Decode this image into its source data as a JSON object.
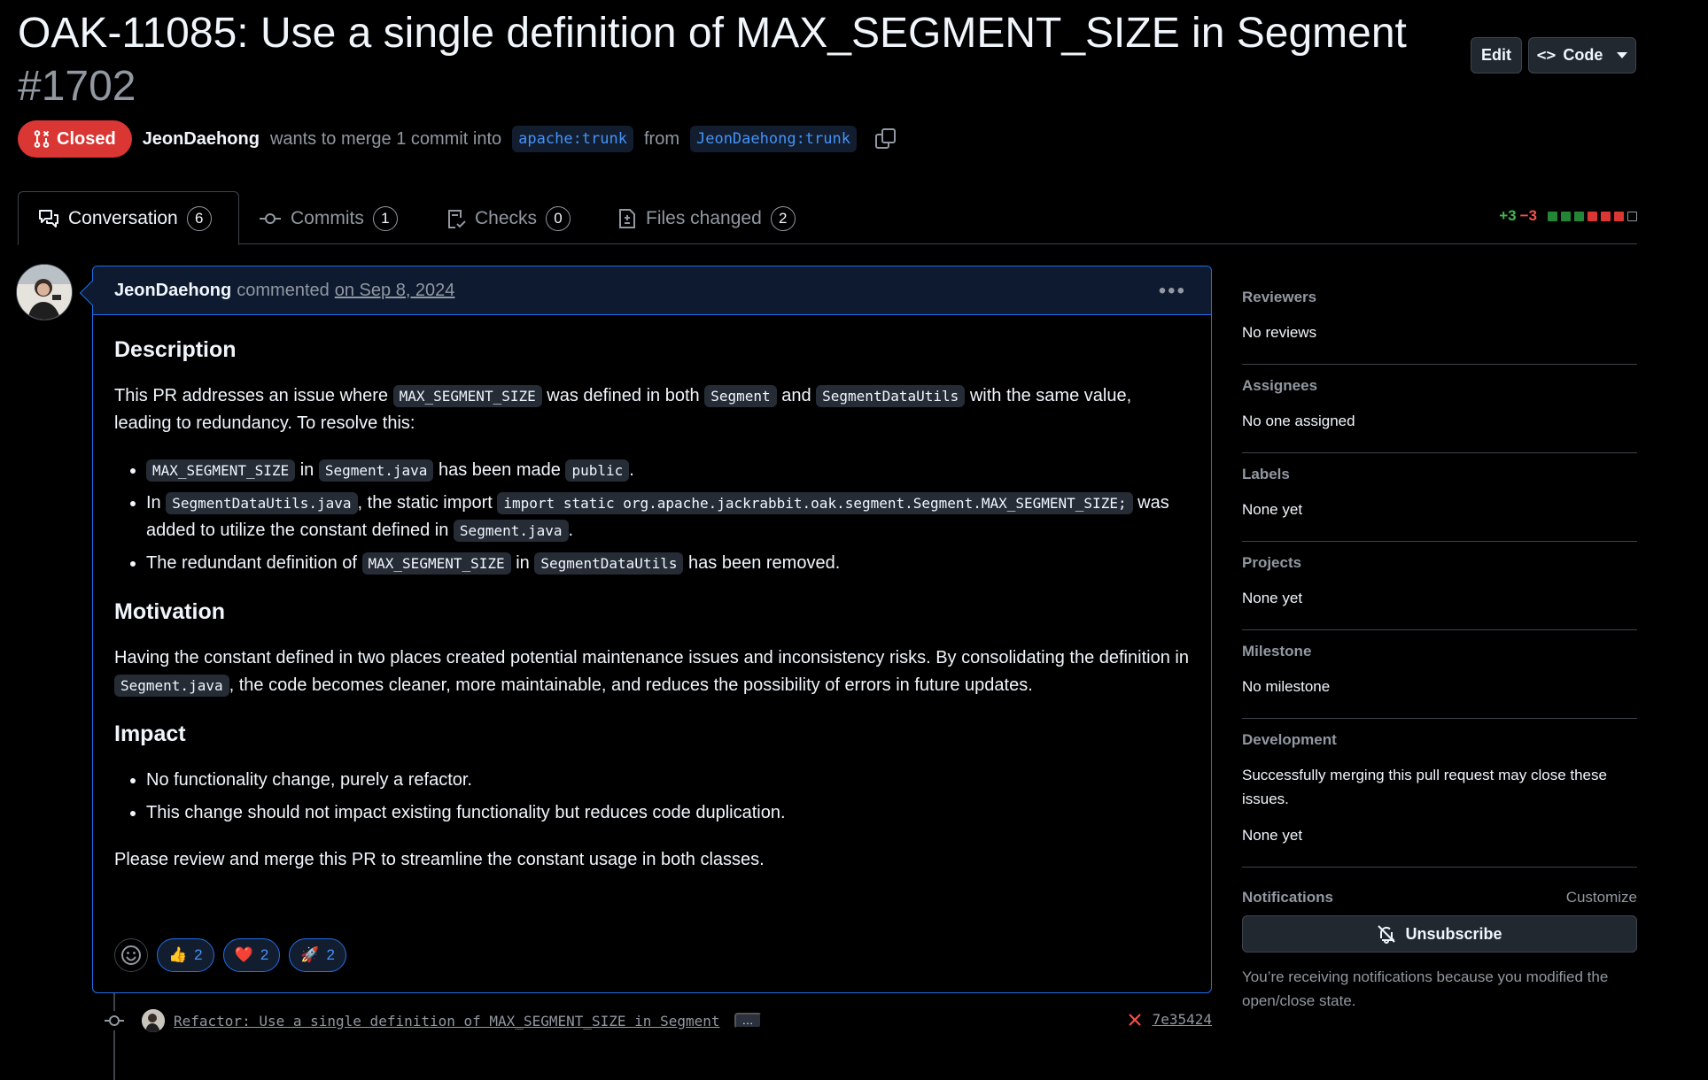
{
  "header": {
    "title": "OAK-11085: Use a single definition of MAX_SEGMENT_SIZE in Segment",
    "number": "#1702",
    "edit_label": "Edit",
    "code_label": "Code",
    "state_label": "Closed",
    "author": "JeonDaehong",
    "merge_text_1": "wants to merge 1 commit into",
    "base_branch": "apache:trunk",
    "merge_text_2": "from",
    "head_branch": "JeonDaehong:trunk"
  },
  "tabs": [
    {
      "label": "Conversation",
      "count": "6"
    },
    {
      "label": "Commits",
      "count": "1"
    },
    {
      "label": "Checks",
      "count": "0"
    },
    {
      "label": "Files changed",
      "count": "2"
    }
  ],
  "diffstat": {
    "additions": "+3",
    "deletions": "−3"
  },
  "colors": {
    "accent": "#1f6feb",
    "danger": "#da3633",
    "success": "#3fb950",
    "bg": "#000000"
  },
  "comment": {
    "author": "JeonDaehong",
    "action": "commented",
    "date": "on Sep 8, 2024",
    "description_heading": "Description",
    "p1_a": "This PR addresses an issue where",
    "p1_code1": "MAX_SEGMENT_SIZE",
    "p1_b": "was defined in both",
    "p1_code2": "Segment",
    "p1_c": "and",
    "p1_code3": "SegmentDataUtils",
    "p1_d": "with the same value, leading to redundancy. To resolve this:",
    "b1_code1": "MAX_SEGMENT_SIZE",
    "b1_a": "in",
    "b1_code2": "Segment.java",
    "b1_b": "has been made",
    "b1_code3": "public",
    "b1_c": ".",
    "b2_a": "In",
    "b2_code1": "SegmentDataUtils.java",
    "b2_b": ", the static import",
    "b2_code2": "import static org.apache.jackrabbit.oak.segment.Segment.MAX_SEGMENT_SIZE;",
    "b2_c": "was added to utilize the constant defined in",
    "b2_code3": "Segment.java",
    "b2_d": ".",
    "b3_a": "The redundant definition of",
    "b3_code1": "MAX_SEGMENT_SIZE",
    "b3_b": "in",
    "b3_code2": "SegmentDataUtils",
    "b3_c": "has been removed.",
    "motivation_heading": "Motivation",
    "m_a": "Having the constant defined in two places created potential maintenance issues and inconsistency risks. By consolidating the definition in",
    "m_code": "Segment.java",
    "m_b": ", the code becomes cleaner, more maintainable, and reduces the possibility of errors in future updates.",
    "impact_heading": "Impact",
    "i1": "No functionality change, purely a refactor.",
    "i2": "This change should not impact existing functionality but reduces code duplication.",
    "closing": "Please review and merge this PR to streamline the constant usage in both classes.",
    "reactions": [
      {
        "emoji": "👍",
        "count": "2"
      },
      {
        "emoji": "❤️",
        "count": "2"
      },
      {
        "emoji": "🚀",
        "count": "2"
      }
    ]
  },
  "commit": {
    "message": "Refactor: Use a single definition of MAX_SEGMENT_SIZE in Segment",
    "ellipsis": "…",
    "status_icon": "x-icon",
    "sha": "7e35424"
  },
  "sidebar": {
    "reviewers_title": "Reviewers",
    "reviewers_value": "No reviews",
    "assignees_title": "Assignees",
    "assignees_value": "No one assigned",
    "labels_title": "Labels",
    "labels_value": "None yet",
    "projects_title": "Projects",
    "projects_value": "None yet",
    "milestone_title": "Milestone",
    "milestone_value": "No milestone",
    "development_title": "Development",
    "development_text": "Successfully merging this pull request may close these issues.",
    "development_value": "None yet",
    "notifications_title": "Notifications",
    "customize_label": "Customize",
    "unsubscribe_label": "Unsubscribe",
    "notifications_text": "You’re receiving notifications because you modified the open/close state."
  }
}
